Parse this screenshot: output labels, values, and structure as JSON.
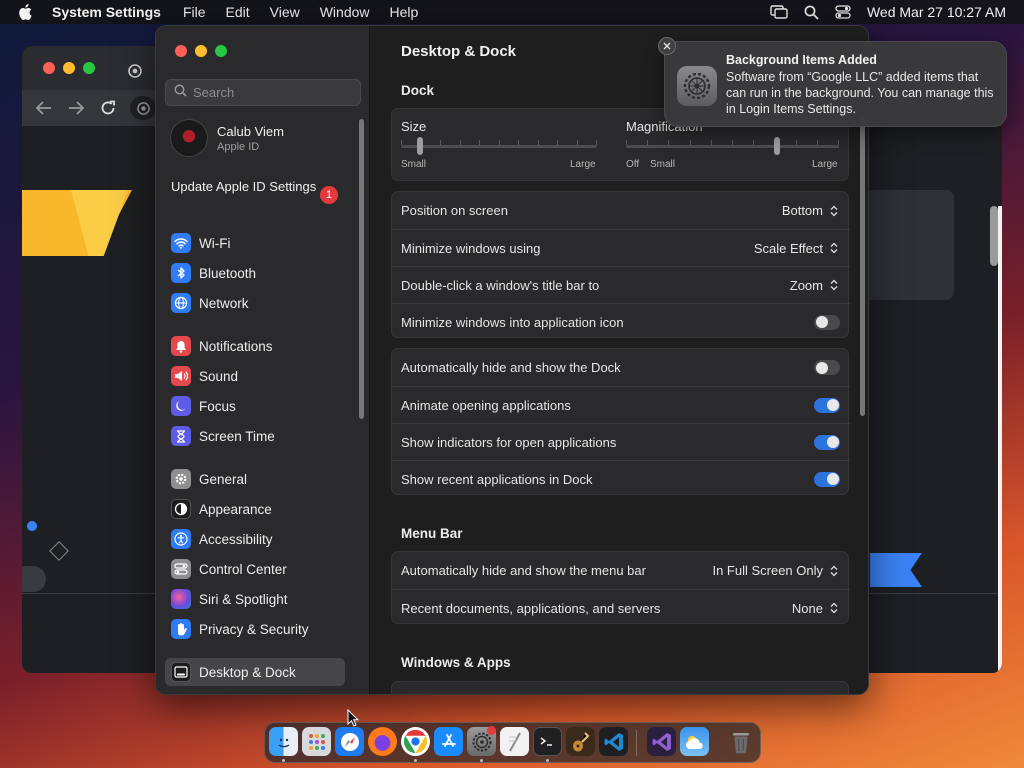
{
  "menubar": {
    "app_name": "System Settings",
    "menus": [
      "File",
      "Edit",
      "View",
      "Window",
      "Help"
    ],
    "datetime": "Wed Mar 27  10:27 AM"
  },
  "sidebar": {
    "search_placeholder": "Search",
    "profile": {
      "name": "Calub Viem",
      "sub": "Apple ID"
    },
    "update": {
      "label": "Update Apple ID Settings",
      "badge": "1"
    },
    "items": [
      {
        "label": "Wi-Fi",
        "icon": "wifi-icon",
        "color": "#2f7cf6"
      },
      {
        "label": "Bluetooth",
        "icon": "bluetooth-icon",
        "color": "#2f7cf6"
      },
      {
        "label": "Network",
        "icon": "globe-icon",
        "color": "#2f7cf6"
      },
      {
        "label": "Notifications",
        "icon": "bell-icon",
        "color": "#e5484d"
      },
      {
        "label": "Sound",
        "icon": "speaker-icon",
        "color": "#e5484d"
      },
      {
        "label": "Focus",
        "icon": "moon-icon",
        "color": "#5e5ce6"
      },
      {
        "label": "Screen Time",
        "icon": "hourglass-icon",
        "color": "#5e5ce6"
      },
      {
        "label": "General",
        "icon": "gear-icon",
        "color": "#8e8e93"
      },
      {
        "label": "Appearance",
        "icon": "appearance-icon",
        "color": "#1c1c1e"
      },
      {
        "label": "Accessibility",
        "icon": "accessibility-icon",
        "color": "#2f7cf6"
      },
      {
        "label": "Control Center",
        "icon": "control-center-icon",
        "color": "#8e8e93"
      },
      {
        "label": "Siri & Spotlight",
        "icon": "siri-icon",
        "color": "#a94fd4"
      },
      {
        "label": "Privacy & Security",
        "icon": "hand-icon",
        "color": "#2f7cf6"
      },
      {
        "label": "Desktop & Dock",
        "icon": "dock-icon",
        "color": "#1c1c1e"
      }
    ]
  },
  "main": {
    "title": "Desktop & Dock",
    "dock_heading": "Dock",
    "size": {
      "label": "Size",
      "min": "Small",
      "max": "Large",
      "value": 0.07
    },
    "magnification": {
      "label": "Magnification",
      "off": "Off",
      "min": "Small",
      "max": "Large",
      "value": 0.68
    },
    "dock_rows": [
      {
        "label": "Position on screen",
        "value": "Bottom"
      },
      {
        "label": "Minimize windows using",
        "value": "Scale Effect"
      },
      {
        "label": "Double-click a window's title bar to",
        "value": "Zoom"
      },
      {
        "label": "Minimize windows into application icon",
        "toggle": false
      }
    ],
    "dock_toggles": [
      {
        "label": "Automatically hide and show the Dock",
        "toggle": false
      },
      {
        "label": "Animate opening applications",
        "toggle": true
      },
      {
        "label": "Show indicators for open applications",
        "toggle": true
      },
      {
        "label": "Show recent applications in Dock",
        "toggle": true
      }
    ],
    "menubar_heading": "Menu Bar",
    "menubar_rows": [
      {
        "label": "Automatically hide and show the menu bar",
        "value": "In Full Screen Only"
      },
      {
        "label": "Recent documents, applications, and servers",
        "value": "None"
      }
    ],
    "windows_heading": "Windows & Apps"
  },
  "notification": {
    "title": "Background Items Added",
    "body": "Software from “Google LLC” added items that can run in the background. You can manage this in Login Items Settings."
  },
  "dock": [
    {
      "name": "finder-icon",
      "color": "#3aa0f5",
      "running": true
    },
    {
      "name": "launchpad-icon",
      "color": "#d9d9dc",
      "running": false
    },
    {
      "name": "safari-icon",
      "color": "#1f7cf0",
      "running": false
    },
    {
      "name": "firefox-icon",
      "color": "#ff7a1a",
      "running": false
    },
    {
      "name": "chrome-icon",
      "color": "#ffffff",
      "running": true
    },
    {
      "name": "app-store-icon",
      "color": "#1a8cff",
      "running": false
    },
    {
      "name": "system-settings-icon",
      "color": "#7b7b7e",
      "running": true,
      "badge": true
    },
    {
      "name": "textedit-icon",
      "color": "#f2f2f2",
      "running": false
    },
    {
      "name": "terminal-icon",
      "color": "#202022",
      "running": true
    },
    {
      "name": "garageband-icon",
      "color": "#c58a3a",
      "running": false
    },
    {
      "name": "vscode-icon",
      "color": "#1f8ad2",
      "running": false
    },
    {
      "name": "visual-studio-icon",
      "color": "#8d5fd3",
      "running": false
    },
    {
      "name": "weather-icon",
      "color": "#3b93ea",
      "running": false
    },
    {
      "name": "trash-icon",
      "color": "#6b6b6e",
      "running": false
    }
  ]
}
